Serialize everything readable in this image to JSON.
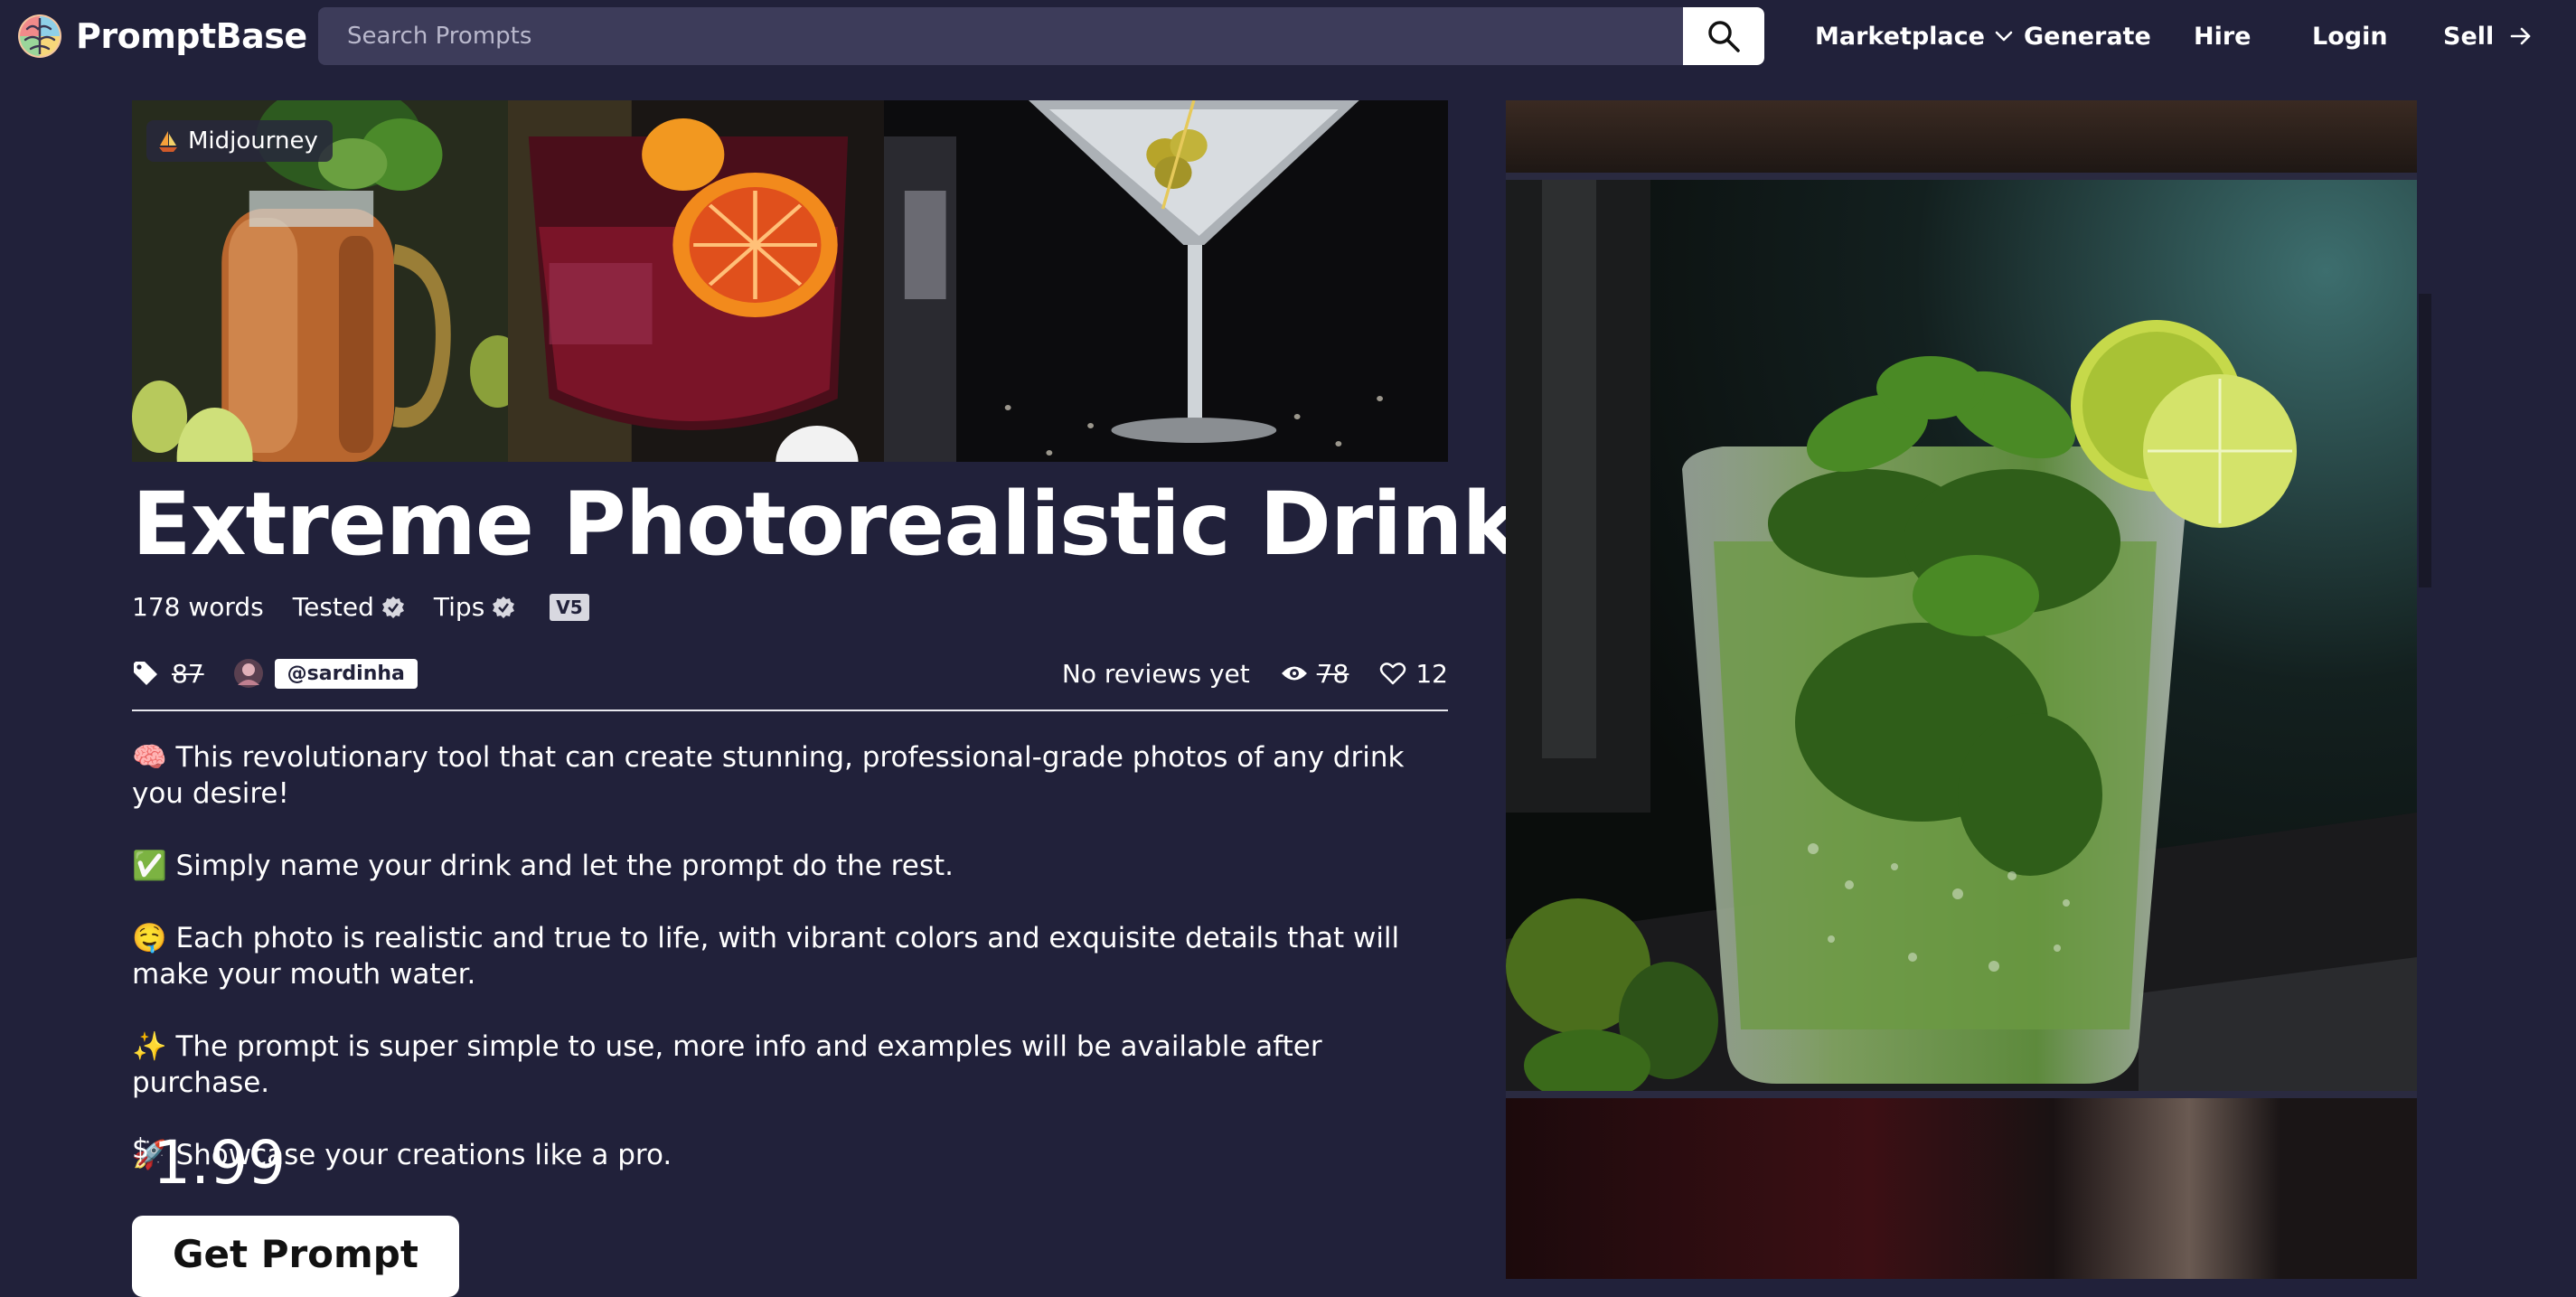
{
  "brand": {
    "name": "PromptBase"
  },
  "search": {
    "placeholder": "Search Prompts"
  },
  "nav": {
    "marketplace": "Marketplace",
    "generate": "Generate",
    "hire": "Hire",
    "login": "Login",
    "sell": "Sell"
  },
  "badge": {
    "icon": "sailboat-icon",
    "label": "Midjourney"
  },
  "title": "Extreme Photorealistic Drinks",
  "meta": {
    "words": "178 words",
    "tested": "Tested",
    "tips": "Tips",
    "version": "V5",
    "tag_count": "87",
    "author": "@sardinha",
    "reviews": "No reviews yet",
    "views": "78",
    "likes": "12"
  },
  "description": [
    {
      "emoji": "🧠",
      "text": "This revolutionary tool that can create stunning, professional-grade photos of any drink you desire!"
    },
    {
      "emoji": "✅",
      "text": "Simply name your drink and let the prompt do the rest."
    },
    {
      "emoji": "🤤",
      "text": "Each photo is realistic and true to life, with vibrant colors and exquisite details that will make your mouth water."
    },
    {
      "emoji": "✨",
      "text": "The prompt is super simple to use, more info and examples will be available after purchase."
    },
    {
      "emoji": "🚀",
      "text": "Showcase your creations like a pro."
    }
  ],
  "price": {
    "currency": "$",
    "amount": "1.99"
  },
  "cta": {
    "label": "Get Prompt"
  },
  "colors": {
    "background": "#21213a",
    "search_bg": "#3d3c5a"
  }
}
